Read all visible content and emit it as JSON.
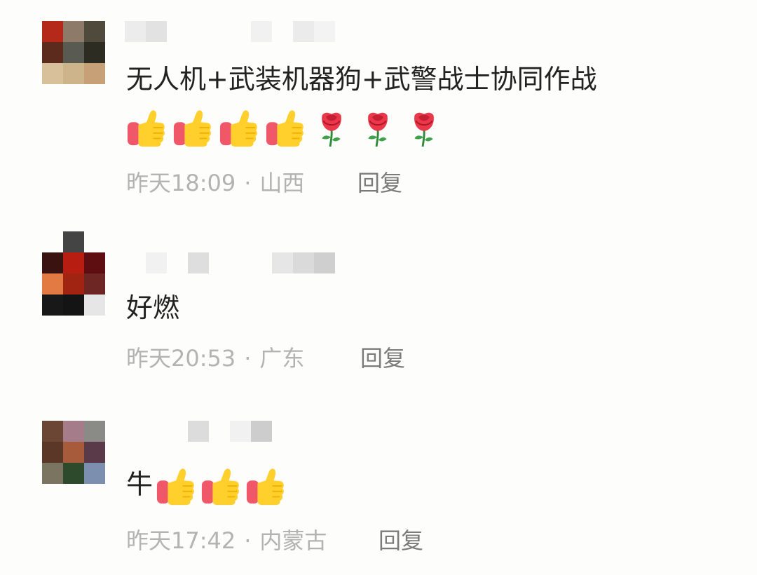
{
  "comments": [
    {
      "text": "无人机+武装机器狗+武警战士协同作战",
      "emojis": [
        "thumbs-up",
        "thumbs-up",
        "thumbs-up",
        "thumbs-up",
        "rose",
        "rose",
        "rose"
      ],
      "time": "昨天18:09",
      "location": "山西",
      "reply_label": "回复"
    },
    {
      "text": "好燃",
      "emojis": [],
      "time": "昨天20:53",
      "location": "广东",
      "reply_label": "回复"
    },
    {
      "text": "牛",
      "emojis": [
        "thumbs-up",
        "thumbs-up",
        "thumbs-up"
      ],
      "time": "昨天17:42",
      "location": "内蒙古",
      "reply_label": "回复"
    }
  ],
  "separator": "·",
  "colors": {
    "text": "#222222",
    "meta": "#b3b3b3",
    "reply": "#7b7b7b",
    "background": "#fdfdfc"
  }
}
